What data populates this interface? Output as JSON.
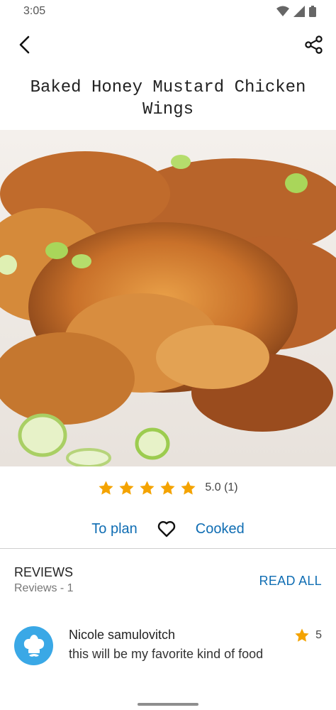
{
  "status": {
    "time": "3:05"
  },
  "recipe": {
    "title": "Baked Honey Mustard Chicken Wings"
  },
  "rating": {
    "stars": 5,
    "display": "5.0 (1)",
    "star_color": "#f4a300"
  },
  "actions": {
    "to_plan": "To plan",
    "cooked": "Cooked"
  },
  "reviews": {
    "heading": "REVIEWS",
    "count_text": "Reviews - 1",
    "read_all": "READ ALL",
    "items": [
      {
        "name": "Nicole samulovitch",
        "text": "this will be my favorite kind of food",
        "stars": "5"
      }
    ]
  },
  "colors": {
    "accent": "#0f6db3",
    "avatar": "#3aa8e6"
  },
  "icons": [
    "back-arrow-icon",
    "share-icon",
    "heart-outline-icon",
    "star-icon",
    "chef-hat-icon",
    "wifi-icon",
    "signal-icon",
    "battery-icon"
  ]
}
